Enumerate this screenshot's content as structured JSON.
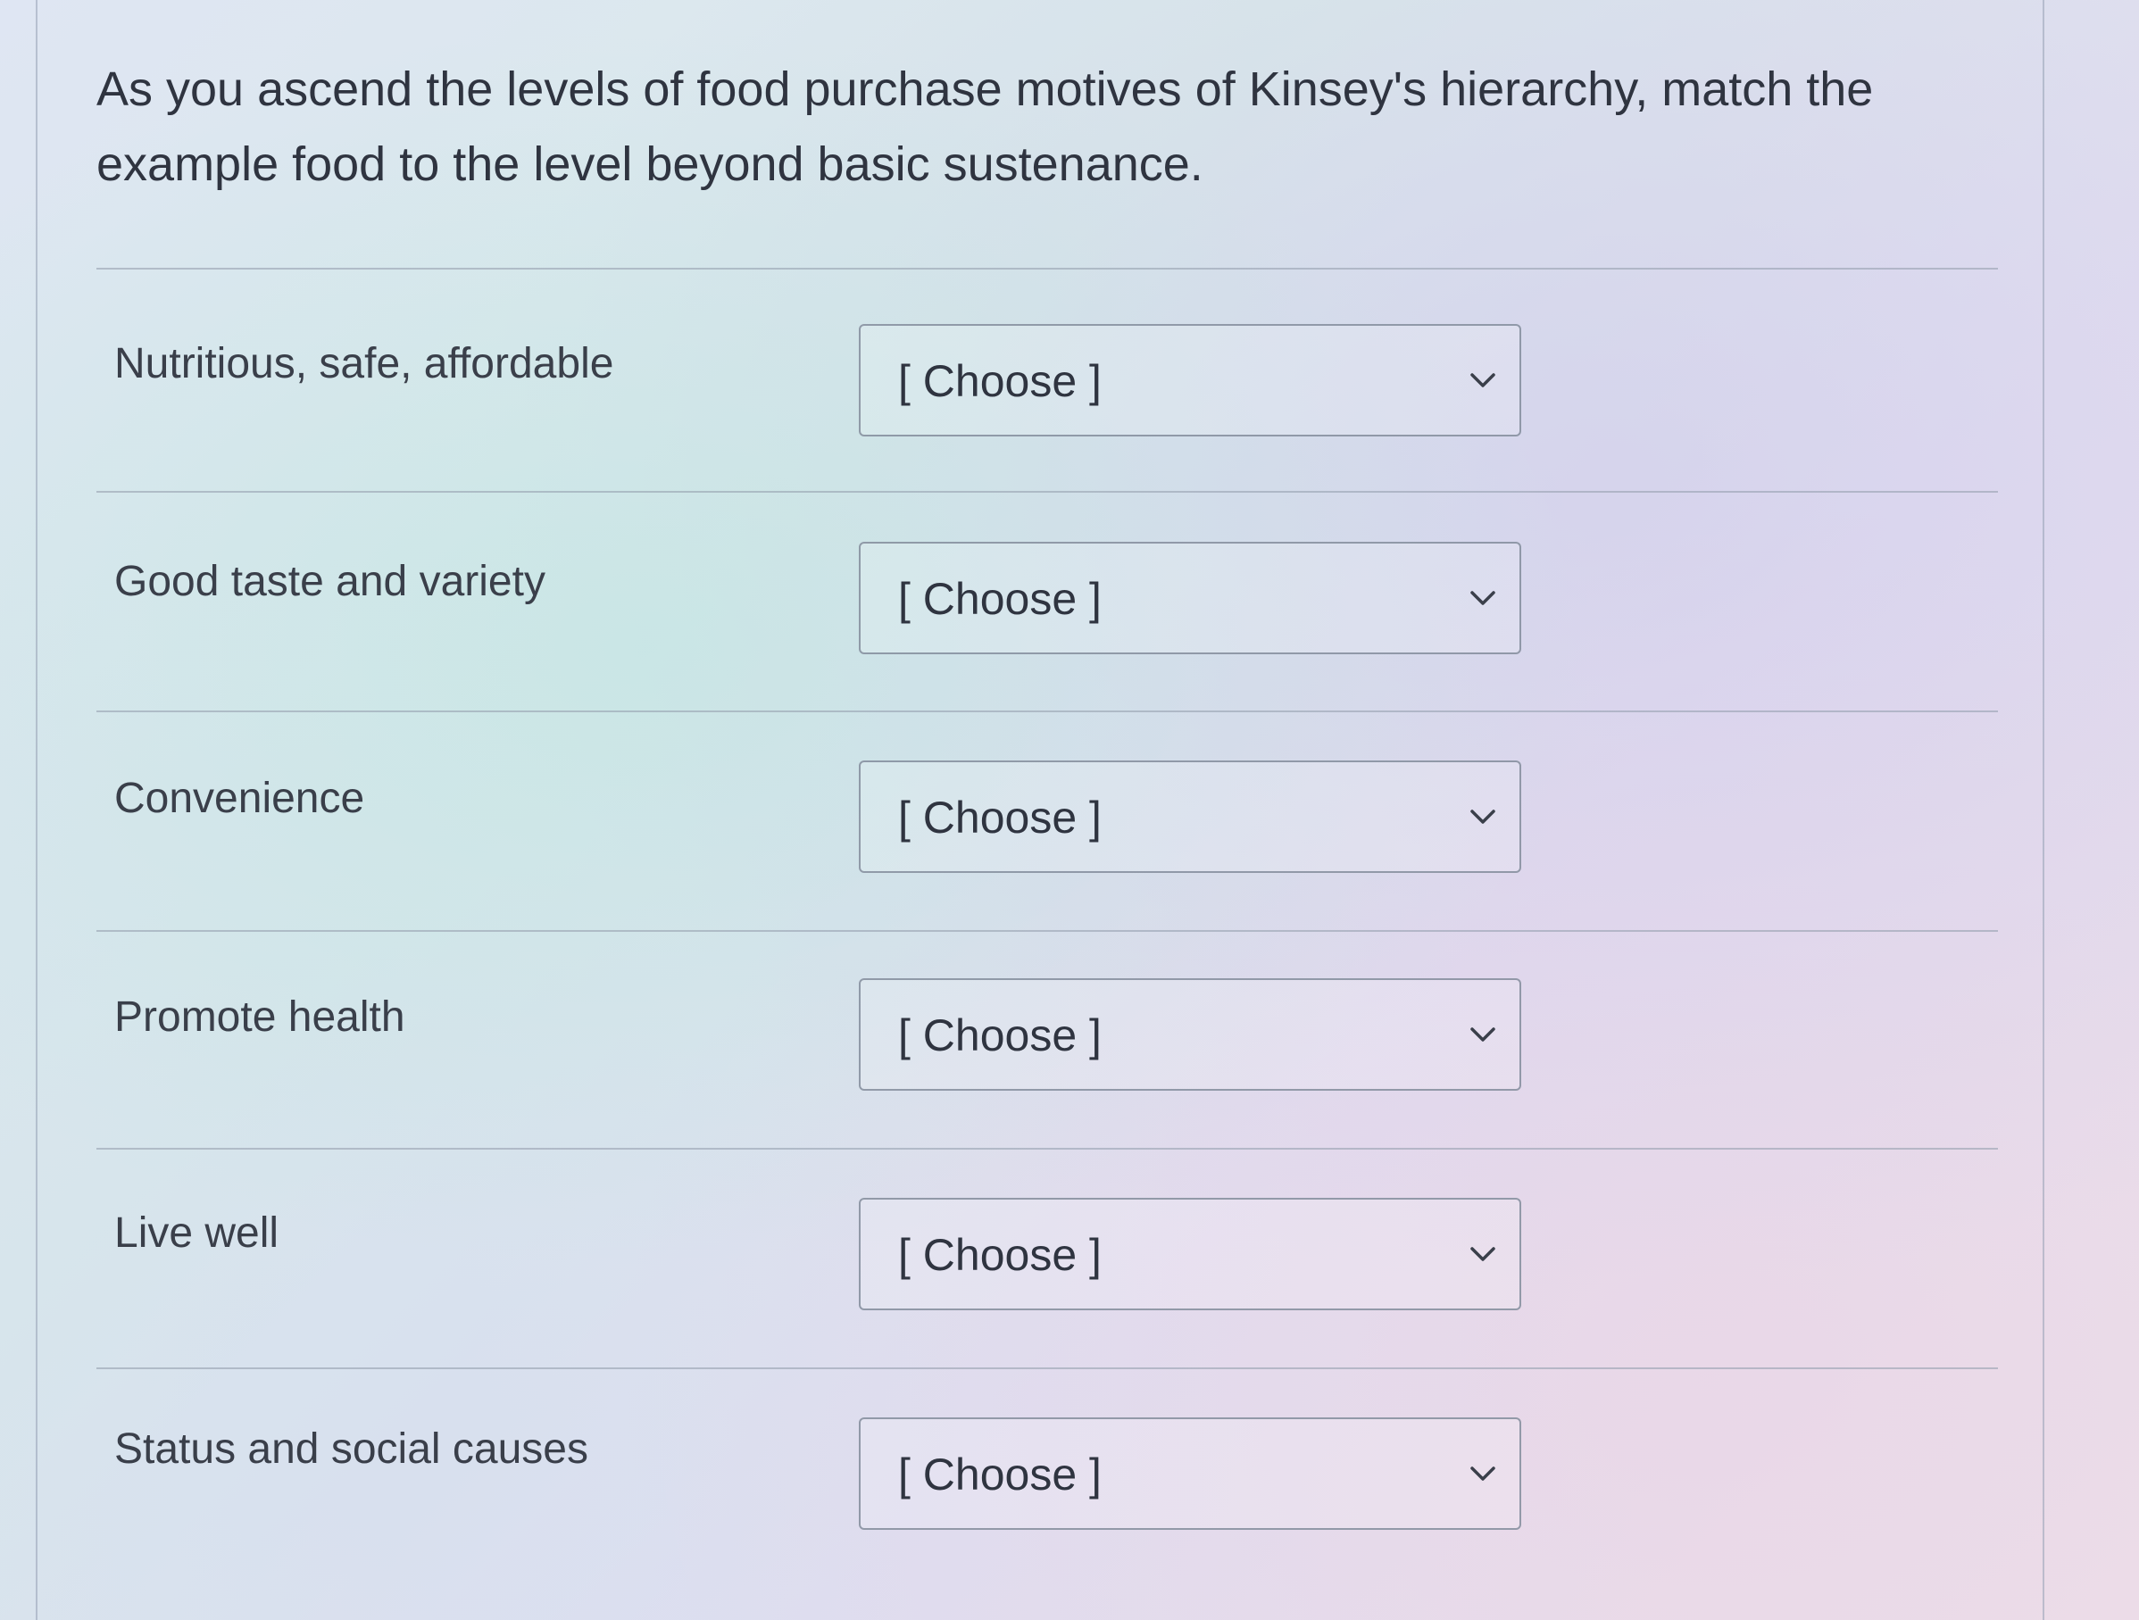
{
  "question": {
    "text": "As you ascend the levels of food purchase motives of Kinsey's hierarchy, match the example food to the level beyond basic sustenance."
  },
  "matching": {
    "rows": [
      {
        "label": "Nutritious, safe, affordable",
        "selected": "[ Choose ]"
      },
      {
        "label": "Good taste and variety",
        "selected": "[ Choose ]"
      },
      {
        "label": "Convenience",
        "selected": "[ Choose ]"
      },
      {
        "label": "Promote health",
        "selected": "[ Choose ]"
      },
      {
        "label": "Live well",
        "selected": "[ Choose ]"
      },
      {
        "label": "Status and social causes",
        "selected": "[ Choose ]"
      }
    ]
  },
  "icons": {
    "dropdown": "chevron-down-icon"
  },
  "colors": {
    "text": "#2f3440",
    "border": "#828c9b"
  }
}
